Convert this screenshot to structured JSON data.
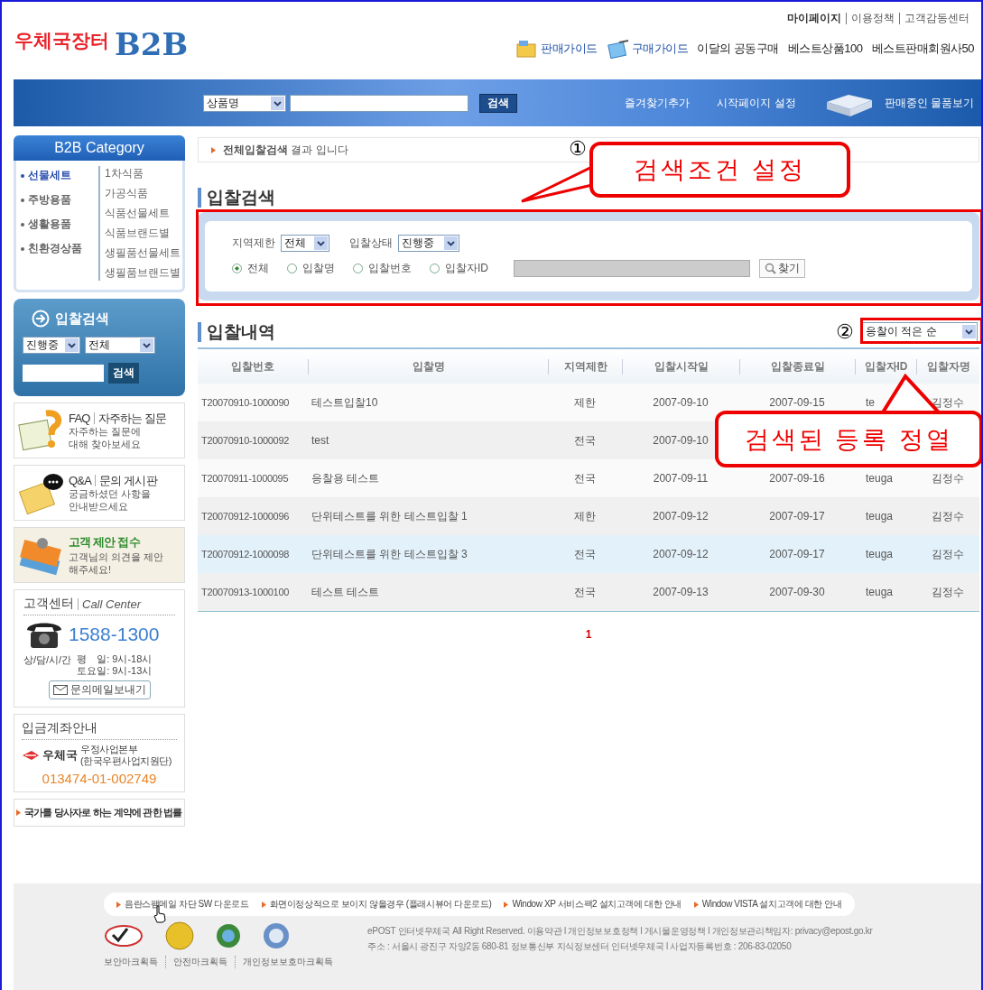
{
  "top_links": [
    {
      "label": "마이페이지",
      "bold": true
    },
    {
      "label": "이용정책",
      "bold": false
    },
    {
      "label": "고객감동센터",
      "bold": false
    }
  ],
  "logo": {
    "text": "우체국장터",
    "badge": "B2B"
  },
  "header_nav": [
    {
      "label": "판매가이드",
      "kind": "sell-guide"
    },
    {
      "label": "구매가이드",
      "kind": "buy-guide"
    },
    {
      "label": "이달의 공동구매",
      "kind": "plain"
    },
    {
      "label": "베스트상품100",
      "kind": "plain"
    },
    {
      "label": "베스트판매회원사50",
      "kind": "plain"
    }
  ],
  "search_bar": {
    "category": "상품명",
    "button": "검색"
  },
  "nav_links": [
    {
      "label": "즐겨찾기추가",
      "kind": "plain"
    },
    {
      "label": "시작페이지 설정",
      "kind": "plain"
    },
    {
      "label": "판매중인 물품보기",
      "kind": "boxes"
    }
  ],
  "category": {
    "title": "B2B Category",
    "items": [
      {
        "label": "선물세트",
        "selected": true
      },
      {
        "label": "주방용품",
        "selected": false
      },
      {
        "label": "생활용품",
        "selected": false
      },
      {
        "label": "친환경상품",
        "selected": false
      }
    ],
    "subitems": [
      "1차식품",
      "가공식품",
      "식품선물세트",
      "식품브랜드별",
      "생필품선물세트",
      "생필품브랜드별"
    ]
  },
  "side_search": {
    "title": "입찰검색",
    "status": "진행중",
    "region": "전체",
    "button": "검색"
  },
  "promo_boxes": [
    {
      "kind": "faq",
      "title": "FAQ",
      "subtitle": "자주하는 질문",
      "lines": [
        "자주하는 질문에",
        "대해 찾아보세요"
      ]
    },
    {
      "kind": "qna",
      "title": "Q&A",
      "subtitle": "문의 게시판",
      "lines": [
        "궁금하셨던 사항을",
        "안내받으세요"
      ]
    },
    {
      "kind": "suggest",
      "title": "고객 제안 접수",
      "lines": [
        "고객님의 의견을 제안",
        "해주세요!"
      ]
    }
  ],
  "call_center": {
    "title": "고객센터",
    "subtitle": "Call Center",
    "phone": "1588-1300",
    "hours_label": "상/담/시/간",
    "hours": [
      "평　일: 9시-18시",
      "토요일: 9시-13시"
    ],
    "button": "문의메일보내기"
  },
  "account": {
    "title": "입금계좌안내",
    "bank": "우체국",
    "holder": [
      "우정사업본부",
      "(한국우편사업지원단)"
    ],
    "number": "013474-01-002749"
  },
  "law_link": "국가를 당사자로 하는 계약에 관한 법률",
  "breadcrumb": "**전체입찰검색** 결과 입니다",
  "search_section": {
    "title": "입찰검색",
    "region_label": "지역제한",
    "region": "전체",
    "status_label": "입찰상태",
    "status": "진행중",
    "radios": [
      {
        "label": "전체",
        "selected": true
      },
      {
        "label": "입찰명",
        "selected": false
      },
      {
        "label": "입찰번호",
        "selected": false
      },
      {
        "label": "입찰자ID",
        "selected": false
      }
    ],
    "find_button": "찾기"
  },
  "results": {
    "title": "입찰내역",
    "sort": "응찰이 적은 순",
    "columns": [
      "입찰번호",
      "입찰명",
      "지역제한",
      "입찰시작일",
      "입찰종료일",
      "입찰자ID",
      "입찰자명"
    ],
    "rows": [
      {
        "number": "T20070910-1000090",
        "name": "테스트입찰10",
        "region": "제한",
        "start": "2007-09-10",
        "end": "2007-09-15",
        "bidder_id": "te",
        "bidder_name": "김정수",
        "highlighted": false
      },
      {
        "number": "T20070910-1000092",
        "name": "test",
        "region": "전국",
        "start": "2007-09-10",
        "highlighted": false
      },
      {
        "number": "T20070911-1000095",
        "name": "응찰용 테스트",
        "region": "전국",
        "start": "2007-09-11",
        "end": "2007-09-16",
        "bidder_id": "teuga",
        "bidder_name": "김정수",
        "highlighted": false
      },
      {
        "number": "T20070912-1000096",
        "name": "단위테스트를 위한 테스트입찰 1",
        "region": "제한",
        "start": "2007-09-12",
        "end": "2007-09-17",
        "bidder_id": "teuga",
        "bidder_name": "김정수",
        "highlighted": false
      },
      {
        "number": "T20070912-1000098",
        "name": "단위테스트를 위한 테스트입찰 3",
        "region": "전국",
        "start": "2007-09-12",
        "end": "2007-09-17",
        "bidder_id": "teuga",
        "bidder_name": "김정수",
        "highlighted": true
      },
      {
        "number": "T20070913-1000100",
        "name": "테스트 테스트",
        "region": "전국",
        "start": "2007-09-13",
        "end": "2007-09-30",
        "bidder_id": "teuga",
        "bidder_name": "김정수",
        "highlighted": false
      }
    ],
    "pages": [
      {
        "label": "1",
        "selected": true
      }
    ]
  },
  "footer": {
    "links": [
      "음란스팸메일 차단 SW 다운로드",
      "화면이정상적으로 보이지 않을경우 (플래시뷰어 다운로드)",
      "Window XP 서비스팩2 설치고객에 대한 안내",
      "Window VISTA 설치고객에 대한 안내"
    ],
    "copyright": [
      "ePOST 인터넷우체국 All Right Reserved. 이용약관 l 개인정보보호정책 l 게시물운영정책  l  개인정보관리책임자: privacy@epost.go.kr",
      "주소 : 서울시 광진구 자양2동 680-81  정보통신부 지식정보센터 인터넷우체국 l 사업자등록번호 : 206-83-02050"
    ],
    "marks": [
      "보안마크획득",
      "안전마크획득",
      "개인정보보호마크획득"
    ]
  },
  "annotations": [
    {
      "number": "①",
      "text": "검색조건 설정"
    },
    {
      "number": "②",
      "text": "검색된 등록 정열"
    }
  ]
}
